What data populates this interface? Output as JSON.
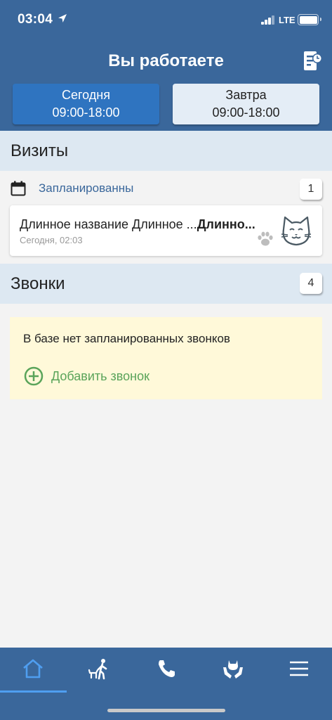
{
  "status_bar": {
    "time": "03:04",
    "network": "LTE"
  },
  "header": {
    "title": "Вы работаете",
    "schedule_icon": "schedule-icon",
    "days": [
      {
        "label": "Сегодня",
        "hours": "09:00-18:00",
        "active": true
      },
      {
        "label": "Завтра",
        "hours": "09:00-18:00",
        "active": false
      }
    ]
  },
  "visits": {
    "title": "Визиты",
    "planned_label": "Запланированны",
    "planned_count": "1",
    "items": [
      {
        "name": "Длинное название Длинное ...",
        "pet": "Длинно...",
        "time": "Сегодня, 02:03",
        "icons": [
          "paw-icon",
          "cat-icon"
        ]
      }
    ]
  },
  "calls": {
    "title": "Звонки",
    "count": "4",
    "empty_text": "В базе нет запланированных звонков",
    "add_label": "Добавить звонок"
  },
  "bottom_nav": [
    {
      "icon": "home-icon",
      "active": true
    },
    {
      "icon": "walking-pet-icon",
      "active": false
    },
    {
      "icon": "phone-icon",
      "active": false
    },
    {
      "icon": "pet-care-icon",
      "active": false
    },
    {
      "icon": "menu-icon",
      "active": false
    }
  ],
  "colors": {
    "header_bg": "#3a679b",
    "active_tab": "#2f74c0",
    "inactive_tab": "#e4edf6",
    "section_bg": "#dde8f2",
    "empty_bg": "#fff9d9",
    "add_green": "#5aa45a",
    "nav_active": "#4f9ef0"
  }
}
